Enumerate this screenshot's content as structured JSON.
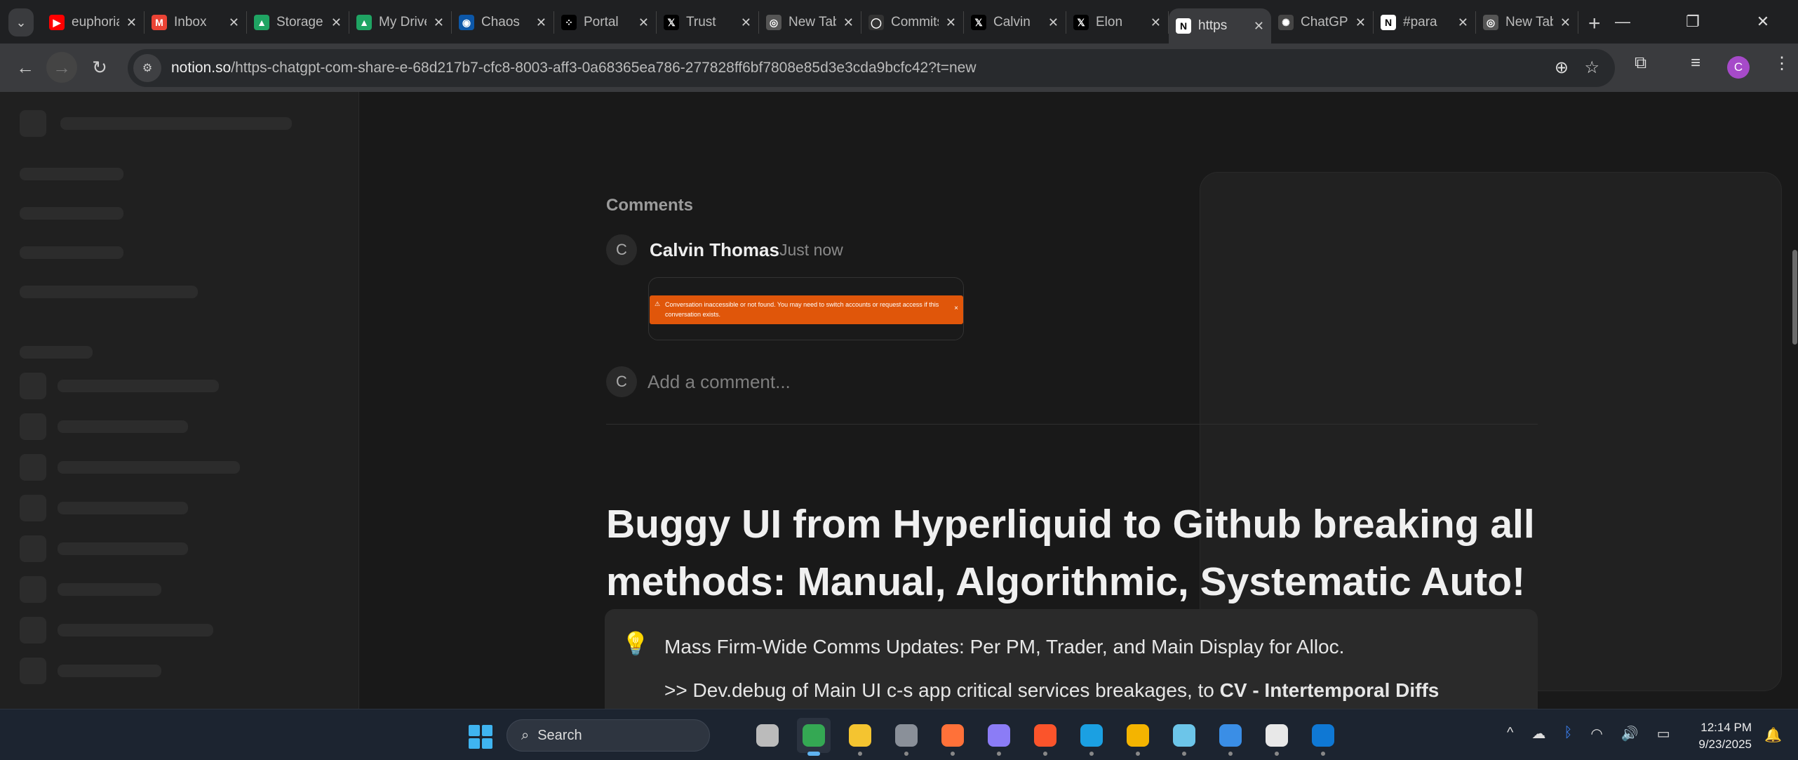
{
  "browser": {
    "tabs": [
      {
        "title": "euphoria",
        "icon": "youtube-icon",
        "color": "#ff0000",
        "glyph": "▶"
      },
      {
        "title": "Inbox",
        "icon": "gmail-icon",
        "color": "#ea4335",
        "glyph": "M"
      },
      {
        "title": "Storage",
        "icon": "google-drive-icon",
        "color": "#1fa463",
        "glyph": "▲"
      },
      {
        "title": "My Drive",
        "icon": "google-drive-icon",
        "color": "#1fa463",
        "glyph": "▲"
      },
      {
        "title": "Chaos",
        "icon": "wikimedia-icon",
        "color": "#0c57a8",
        "glyph": "◉"
      },
      {
        "title": "Portal",
        "icon": "portal-icon",
        "color": "#000000",
        "glyph": "⁘"
      },
      {
        "title": "Trust",
        "icon": "x-icon",
        "color": "#000000",
        "glyph": "𝕏"
      },
      {
        "title": "New Tab",
        "icon": "chrome-icon",
        "color": "#555555",
        "glyph": "◎"
      },
      {
        "title": "Commits",
        "icon": "github-icon",
        "color": "#333333",
        "glyph": "◯"
      },
      {
        "title": "Calvin",
        "icon": "x-icon",
        "color": "#000000",
        "glyph": "𝕏"
      },
      {
        "title": "Elon",
        "icon": "x-icon",
        "color": "#000000",
        "glyph": "𝕏"
      },
      {
        "title": "https",
        "icon": "notion-icon",
        "color": "#ffffff",
        "glyph": "N",
        "active": true
      },
      {
        "title": "ChatGPT",
        "icon": "openai-icon",
        "color": "#444444",
        "glyph": "✺"
      },
      {
        "title": "#para",
        "icon": "notion-icon",
        "color": "#ffffff",
        "glyph": "N"
      },
      {
        "title": "New Tab",
        "icon": "chrome-icon",
        "color": "#555555",
        "glyph": "◎"
      }
    ],
    "url_host": "notion.so",
    "url_path": "/https-chatgpt-com-share-e-68d217b7-cfc8-8003-aff3-0a68365ea786-277828ff6bf7808e85d3e3cda9bcfc42?t=new",
    "profile_initial": "C"
  },
  "comments": {
    "heading": "Comments",
    "avatar_initial": "C",
    "author": "Calvin Thomas",
    "time": "Just now",
    "error_text": "Conversation inaccessible or not found. You may need to switch accounts or request access if this conversation exists.",
    "error_color": "#e0560a",
    "placeholder": "Add a comment..."
  },
  "page": {
    "title": "Buggy UI from Hyperliquid to Github breaking all methods: Manual, Algorithmic, Systematic Auto!",
    "callout_line1": "Mass Firm-Wide Comms Updates: Per PM, Trader, and Main Display for Alloc.",
    "callout_line2_prefix": ">> Dev.debug of Main UI c-s app critical services breakages, to ",
    "callout_line2_bold": "CV - Intertemporal Diffs"
  },
  "taskbar": {
    "search_label": "Search",
    "time": "12:14 PM",
    "date": "9/23/2025"
  }
}
